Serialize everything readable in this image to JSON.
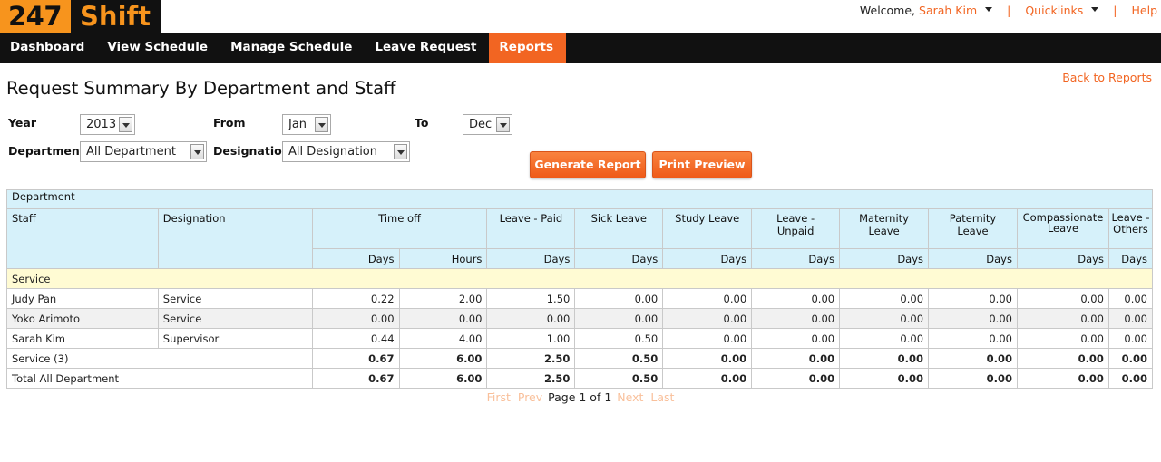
{
  "logo": {
    "num": "247",
    "word": "Shift"
  },
  "top": {
    "welcome": "Welcome,",
    "user": "Sarah Kim",
    "quicklinks": "Quicklinks",
    "help": "Help",
    "sep": "|"
  },
  "nav": [
    "Dashboard",
    "View Schedule",
    "Manage Schedule",
    "Leave Request",
    "Reports"
  ],
  "back_link": "Back to Reports",
  "title": "Request Summary By Department and Staff",
  "form": {
    "year_label": "Year",
    "year_value": "2013",
    "from_label": "From",
    "from_value": "Jan",
    "to_label": "To",
    "to_value": "Dec",
    "department_label": "Department",
    "department_value": "All Department",
    "designation_label": "Designation",
    "designation_value": "All Designation",
    "generate": "Generate Report",
    "print": "Print Preview"
  },
  "table": {
    "department_header": "Department",
    "staff_header": "Staff",
    "designation_header": "Designation",
    "columns": [
      "Time off",
      "Leave - Paid",
      "Sick Leave",
      "Study Leave",
      "Leave - Unpaid",
      "Maternity Leave",
      "Paternity Leave",
      "Compassionate Leave",
      "Leave - Others"
    ],
    "subheaders": [
      "Days",
      "Hours",
      "Days",
      "Days",
      "Days",
      "Days",
      "Days",
      "Days",
      "Days",
      "Days"
    ],
    "group": "Service",
    "rows": [
      {
        "staff": "Judy Pan",
        "designation": "Service",
        "values": [
          "0.22",
          "2.00",
          "1.50",
          "0.00",
          "0.00",
          "0.00",
          "0.00",
          "0.00",
          "0.00",
          "0.00"
        ]
      },
      {
        "staff": "Yoko Arimoto",
        "designation": "Service",
        "values": [
          "0.00",
          "0.00",
          "0.00",
          "0.00",
          "0.00",
          "0.00",
          "0.00",
          "0.00",
          "0.00",
          "0.00"
        ]
      },
      {
        "staff": "Sarah Kim",
        "designation": "Supervisor",
        "values": [
          "0.44",
          "4.00",
          "1.00",
          "0.50",
          "0.00",
          "0.00",
          "0.00",
          "0.00",
          "0.00",
          "0.00"
        ]
      }
    ],
    "subtotal": {
      "label": "Service (3)",
      "values": [
        "0.67",
        "6.00",
        "2.50",
        "0.50",
        "0.00",
        "0.00",
        "0.00",
        "0.00",
        "0.00",
        "0.00"
      ]
    },
    "total": {
      "label": "Total All Department",
      "values": [
        "0.67",
        "6.00",
        "2.50",
        "0.50",
        "0.00",
        "0.00",
        "0.00",
        "0.00",
        "0.00",
        "0.00"
      ]
    }
  },
  "pager": {
    "first": "First",
    "prev": "Prev",
    "page_text": "Page 1 of 1",
    "next": "Next",
    "last": "Last"
  },
  "colors": {
    "accent": "#f26522",
    "nav_bg": "#111111",
    "header_bg": "#d6f1fa",
    "group_bg": "#fffbd3"
  }
}
